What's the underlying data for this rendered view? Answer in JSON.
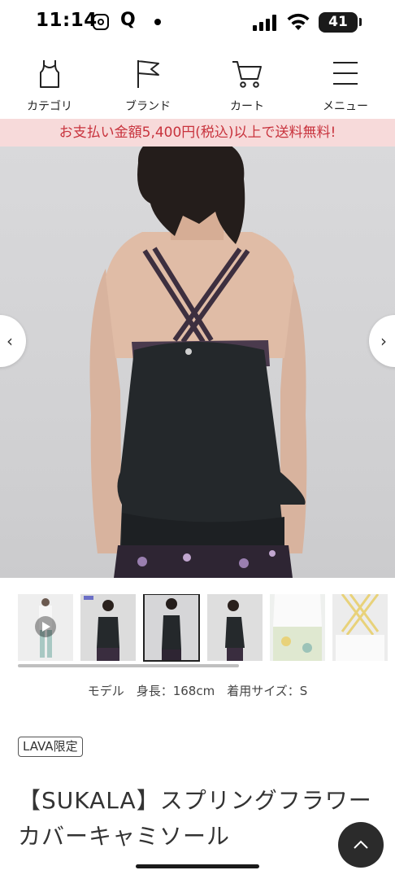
{
  "status_bar": {
    "time": "11:14",
    "battery": "41"
  },
  "nav": {
    "items": [
      {
        "label": "カテゴリ",
        "icon": "tank-top-icon"
      },
      {
        "label": "ブランド",
        "icon": "flag-icon"
      },
      {
        "label": "カート",
        "icon": "cart-icon"
      },
      {
        "label": "メニュー",
        "icon": "hamburger-menu-icon"
      }
    ]
  },
  "banner": {
    "text": "お支払い金額5,400円(税込)以上で送料無料!"
  },
  "gallery": {
    "prev_icon": "chevron-left-icon",
    "next_icon": "chevron-right-icon",
    "thumbnail_count": 6,
    "active_thumbnail_index": 2
  },
  "model_info": "モデル　身長：168cm　着用サイズ：S",
  "product": {
    "badge": "LAVA限定",
    "title": "【SUKALA】スプリングフラワーカバーキャミソール"
  },
  "colors": {
    "banner_bg": "#f7dada",
    "banner_text": "#c8333d",
    "scroll_top_bg": "#2b2b2b"
  }
}
